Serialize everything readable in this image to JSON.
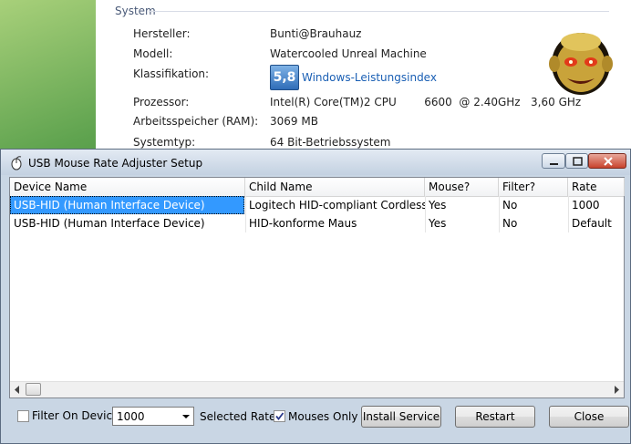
{
  "system_panel": {
    "section_title": "System",
    "rows": [
      {
        "label": "Hersteller:",
        "value": "Bunti@Brauhauz"
      },
      {
        "label": "Modell:",
        "value": "Watercooled Unreal Machine"
      },
      {
        "label": "Klassifikation:",
        "value": ""
      },
      {
        "label": "Prozessor:",
        "value": "Intel(R) Core(TM)2 CPU        6600  @ 2.40GHz   3,60 GHz"
      },
      {
        "label": "Arbeitsspeicher (RAM):",
        "value": "3069 MB"
      },
      {
        "label": "Systemtyp:",
        "value": "64 Bit-Betriebssystem"
      }
    ],
    "wei_score": "5,8",
    "wei_link": "Windows-Leistungsindex"
  },
  "window": {
    "title": "USB Mouse Rate Adjuster Setup",
    "icon": "mouse-icon"
  },
  "table": {
    "columns": [
      "Device Name",
      "Child Name",
      "Mouse?",
      "Filter?",
      "Rate"
    ],
    "rows": [
      {
        "device": "USB-HID (Human Interface Device)",
        "child": "Logitech HID-compliant Cordless Mouse",
        "mouse": "Yes",
        "filter": "No",
        "rate": "1000"
      },
      {
        "device": "USB-HID (Human Interface Device)",
        "child": "HID-konforme Maus",
        "mouse": "Yes",
        "filter": "No",
        "rate": "Default"
      }
    ]
  },
  "controls": {
    "filter_label": "Filter On Device",
    "filter_checked": false,
    "rate_value": "1000",
    "selected_rate_label": "Selected Rate",
    "mouses_only_label": "Mouses Only",
    "mouses_only_checked": true,
    "install_label": "Install Service",
    "restart_label": "Restart",
    "close_label": "Close"
  },
  "colors": {
    "selection": "#3399ff",
    "close_button": "#c8432d",
    "link": "#1a5fb4"
  }
}
